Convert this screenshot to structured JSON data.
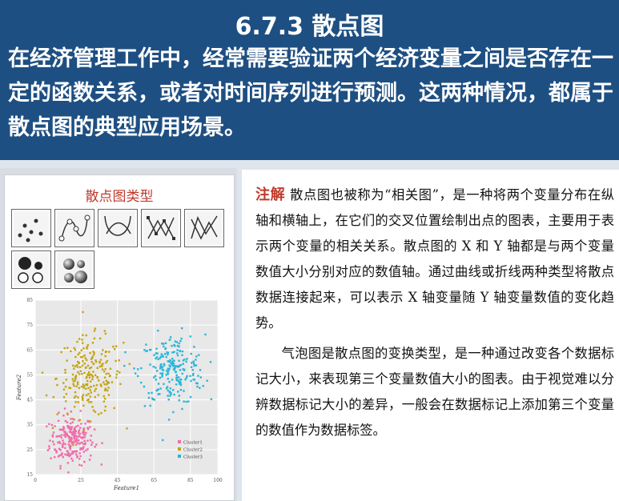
{
  "header": {
    "title": "6.7.3 散点图",
    "intro": "在经济管理工作中，经常需要验证两个经济变量之间是否存在一定的函数关系，或者对时间序列进行预测。这两种情况，都属于散点图的典型应用场景。"
  },
  "figure": {
    "title": "散点图类型",
    "icons": [
      "scatter-points-icon",
      "scatter-smooth-lines-markers-icon",
      "scatter-smooth-lines-icon",
      "scatter-straight-lines-markers-icon",
      "scatter-straight-lines-icon",
      "bubble-icon",
      "bubble-3d-icon"
    ]
  },
  "note": {
    "label": "注解",
    "para1": "散点图也被称为“相关图”，是一种将两个变量分布在纵轴和横轴上，在它们的交叉位置绘制出点的图表，主要用于表示两个变量的相关关系。散点图的 X 和 Y 轴都是与两个变量数值大小分别对应的数值轴。通过曲线或折线两种类型将散点数据连接起来，可以表示 X 轴变量随 Y 轴变量数值的变化趋势。",
    "para2": "气泡图是散点图的变换类型，是一种通过改变各个数据标记大小，来表现第三个变量数值大小的图表。由于视觉难以分辨数据标记大小的差异，一般会在数据标记上添加第三个变量的数值作为数据标签。"
  },
  "chart_data": {
    "type": "scatter",
    "xlabel": "Feature1",
    "ylabel": "Feature2",
    "xlim": [
      0,
      100
    ],
    "ylim": [
      15,
      85
    ],
    "xticks": [
      "0",
      "25",
      "45",
      "65",
      "85",
      "100"
    ],
    "yticks": [
      "15",
      "25",
      "35",
      "45",
      "55",
      "65",
      "75",
      "85"
    ],
    "grid": true,
    "legend": "bottom-right",
    "series": [
      {
        "name": "Cluster1",
        "color": "#f06ca8",
        "center": [
          20,
          29
        ],
        "spread": [
          6,
          5
        ],
        "count": 230
      },
      {
        "name": "Cluster2",
        "color": "#c5a312",
        "center": [
          30,
          54
        ],
        "spread": [
          9,
          8
        ],
        "count": 230
      },
      {
        "name": "Cluster3",
        "color": "#2ab5d9",
        "center": [
          75,
          57
        ],
        "spread": [
          9,
          7
        ],
        "count": 230
      }
    ]
  }
}
